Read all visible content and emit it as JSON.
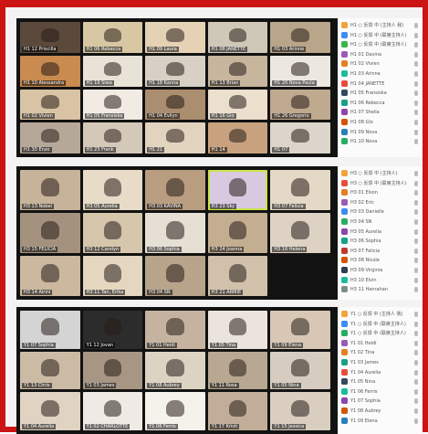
{
  "panels": [
    {
      "tiles": [
        {
          "name": "H1 12 Priscilla",
          "bg": "#5b4a3c"
        },
        {
          "name": "H1 06 Rebecca",
          "bg": "#d8c7a3"
        },
        {
          "name": "H1 09 Laura",
          "bg": "#e5d2b5"
        },
        {
          "name": "H1 08 JANETTE",
          "bg": "#cfc7b8"
        },
        {
          "name": "H1 03 Arinne",
          "bg": "#b9a58a"
        },
        {
          "name": "H1 10 Alessandra",
          "bg": "#c98b4f"
        },
        {
          "name": "H1 19 Siwa",
          "bg": "#e9e2d6"
        },
        {
          "name": "H1 18 Kanna",
          "bg": "#d8d0c4"
        },
        {
          "name": "H1 13 Brian",
          "bg": "#c7b59d"
        },
        {
          "name": "H1 20 Nova Paula",
          "bg": "#ece7e0"
        },
        {
          "name": "H1 02 Vivien",
          "bg": "#d9c3a5"
        },
        {
          "name": "H1 05 Fransiska",
          "bg": "#f1ebe4"
        },
        {
          "name": "H1 04 Evilyn",
          "bg": "#ab8d70"
        },
        {
          "name": "H1 16 Glo",
          "bg": "#ecdfcd"
        },
        {
          "name": "H1 26 Gregorio",
          "bg": "#bfa98f"
        },
        {
          "name": "H1 30 Enzo",
          "bg": "#b6a899"
        },
        {
          "name": "H1 23 Frank",
          "bg": "#d4c8b8"
        },
        {
          "name": "H1 21",
          "bg": "#e2d3bf"
        },
        {
          "name": "H1 14",
          "bg": "#c8a27e"
        },
        {
          "name": "H1 07",
          "bg": "#dcd5cb"
        }
      ],
      "participants": [
        {
          "label": "H1 ○ 反馈 中 (主持人 我)",
          "color": "#f2a43c"
        },
        {
          "label": "H1 ○ 反馈 中 (联席主持人)",
          "color": "#3c8cf2"
        },
        {
          "label": "H1 ○ 反馈 中 (联席主持人)",
          "color": "#39b54a"
        },
        {
          "label": "H1 01 Davina",
          "color": "#9b59b6"
        },
        {
          "label": "H1 02 Vivien",
          "color": "#e67e22"
        },
        {
          "label": "H1 03 Arinne",
          "color": "#1abc9c"
        },
        {
          "label": "H1 04 JANETTE",
          "color": "#e74c3c"
        },
        {
          "label": "H1 05 Fransiska",
          "color": "#34495e"
        },
        {
          "label": "H1 06 Rebecca",
          "color": "#16a085"
        },
        {
          "label": "H1 07 Sheila",
          "color": "#8e44ad"
        },
        {
          "label": "H1 08 Glo",
          "color": "#d35400"
        },
        {
          "label": "H1 09 Nova",
          "color": "#2980b9"
        },
        {
          "label": "H1 10 Nova",
          "color": "#27ae60"
        }
      ]
    },
    {
      "tiles": [
        {
          "name": "H3 13 Nobel",
          "bg": "#c7b29a"
        },
        {
          "name": "H3 05 Aurelia",
          "bg": "#e8dcc8"
        },
        {
          "name": "H3 03 KAVINA",
          "bg": "#b99d80"
        },
        {
          "name": "H3 23 Sky",
          "bg": "#d9c9e0"
        },
        {
          "name": "H3 07 Felicia",
          "bg": "#e4d8c6"
        },
        {
          "name": "H3 15 FELICIA",
          "bg": "#a4927f"
        },
        {
          "name": "H3 12 Carolyn",
          "bg": "#d6c6ab"
        },
        {
          "name": "H3 06 Sophia",
          "bg": "#e6dfd4"
        },
        {
          "name": "H3 24 Joanna",
          "bg": "#c3ae92"
        },
        {
          "name": "H3 16 Helena",
          "bg": "#ddd2c3"
        },
        {
          "name": "H3 14 Airini",
          "bg": "#cbb89f"
        },
        {
          "name": "H3 11 Tan, Erika",
          "bg": "#e5d6c0"
        },
        {
          "name": "H3 04 SN",
          "bg": "#b8a48b"
        },
        {
          "name": "H3 21 ARMIE",
          "bg": "#d1c1ab"
        }
      ],
      "participants": [
        {
          "label": "H3 ○ 反馈 中 (主持人)",
          "color": "#f2a43c"
        },
        {
          "label": "H3 ○ 反馈 中 (联席主持人)",
          "color": "#e74c3c"
        },
        {
          "label": "H3 01 Elson",
          "color": "#e67e22"
        },
        {
          "label": "H3 02 Eric",
          "color": "#9b59b6"
        },
        {
          "label": "H3 03 Danielle",
          "color": "#3c8cf2"
        },
        {
          "label": "H3 04 SN",
          "color": "#27ae60"
        },
        {
          "label": "H3 05 Aurelia",
          "color": "#8e44ad"
        },
        {
          "label": "H3 06 Sophia",
          "color": "#16a085"
        },
        {
          "label": "H3 07 Felicia",
          "color": "#c0392b"
        },
        {
          "label": "H3 08 Nicole",
          "color": "#d35400"
        },
        {
          "label": "H3 09 Virginia",
          "color": "#2c3e50"
        },
        {
          "label": "H3 10 Elvin",
          "color": "#1abc9c"
        },
        {
          "label": "H3 11 Hanrahan",
          "color": "#7f8c8d"
        }
      ]
    },
    {
      "tiles": [
        {
          "name": "Y1 07 Sophia",
          "bg": "#d4d4d4"
        },
        {
          "name": "Y1 12 Jovan",
          "bg": "#2c2c2c"
        },
        {
          "name": "Y1 01 Heidi",
          "bg": "#c5b3a0"
        },
        {
          "name": "Y1 05 Tina",
          "bg": "#eae4dc"
        },
        {
          "name": "Y1 09 Elena",
          "bg": "#d8c7b4"
        },
        {
          "name": "Y1 13 Chris",
          "bg": "#ccbba4"
        },
        {
          "name": "Y1 03 James",
          "bg": "#a89684"
        },
        {
          "name": "Y1 08 Aubrey",
          "bg": "#ddd3c3"
        },
        {
          "name": "Y1 11 Rosa",
          "bg": "#b8a891"
        },
        {
          "name": "Y1 05 Nina",
          "bg": "#d6ccbf"
        },
        {
          "name": "Y1 04 Aurelia",
          "bg": "#e0d3c2"
        },
        {
          "name": "Y1 02 CHARLOTTE",
          "bg": "#efeae3"
        },
        {
          "name": "Y1 06 Ferris",
          "bg": "#f5f2ec"
        },
        {
          "name": "Y1 17 Kristi",
          "bg": "#c2ae98"
        },
        {
          "name": "Y1 15 Jessica",
          "bg": "#d9cebf"
        }
      ],
      "participants": [
        {
          "label": "Y1 ○ 反馈 中 (主持人 我)",
          "color": "#f2a43c"
        },
        {
          "label": "Y1 ○ 反馈 中 (联席主持人)",
          "color": "#3c8cf2"
        },
        {
          "label": "Y1 ○ 反馈 中 (联席主持人)",
          "color": "#27ae60"
        },
        {
          "label": "Y1 01 Heidi",
          "color": "#9b59b6"
        },
        {
          "label": "Y1 02 Tina",
          "color": "#e67e22"
        },
        {
          "label": "Y1 03 James",
          "color": "#16a085"
        },
        {
          "label": "Y1 04 Aurelia",
          "color": "#e74c3c"
        },
        {
          "label": "Y1 05 Nina",
          "color": "#34495e"
        },
        {
          "label": "Y1 06 Ferris",
          "color": "#1abc9c"
        },
        {
          "label": "Y1 07 Sophia",
          "color": "#8e44ad"
        },
        {
          "label": "Y1 08 Aubrey",
          "color": "#d35400"
        },
        {
          "label": "Y1 09 Elena",
          "color": "#2980b9"
        }
      ]
    }
  ]
}
